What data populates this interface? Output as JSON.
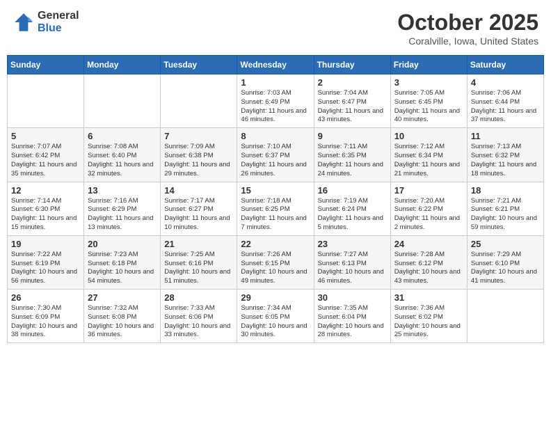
{
  "logo": {
    "general": "General",
    "blue": "Blue"
  },
  "title": "October 2025",
  "location": "Coralville, Iowa, United States",
  "days_of_week": [
    "Sunday",
    "Monday",
    "Tuesday",
    "Wednesday",
    "Thursday",
    "Friday",
    "Saturday"
  ],
  "weeks": [
    [
      {
        "day": "",
        "info": ""
      },
      {
        "day": "",
        "info": ""
      },
      {
        "day": "",
        "info": ""
      },
      {
        "day": "1",
        "info": "Sunrise: 7:03 AM\nSunset: 6:49 PM\nDaylight: 11 hours and 46 minutes."
      },
      {
        "day": "2",
        "info": "Sunrise: 7:04 AM\nSunset: 6:47 PM\nDaylight: 11 hours and 43 minutes."
      },
      {
        "day": "3",
        "info": "Sunrise: 7:05 AM\nSunset: 6:45 PM\nDaylight: 11 hours and 40 minutes."
      },
      {
        "day": "4",
        "info": "Sunrise: 7:06 AM\nSunset: 6:44 PM\nDaylight: 11 hours and 37 minutes."
      }
    ],
    [
      {
        "day": "5",
        "info": "Sunrise: 7:07 AM\nSunset: 6:42 PM\nDaylight: 11 hours and 35 minutes."
      },
      {
        "day": "6",
        "info": "Sunrise: 7:08 AM\nSunset: 6:40 PM\nDaylight: 11 hours and 32 minutes."
      },
      {
        "day": "7",
        "info": "Sunrise: 7:09 AM\nSunset: 6:38 PM\nDaylight: 11 hours and 29 minutes."
      },
      {
        "day": "8",
        "info": "Sunrise: 7:10 AM\nSunset: 6:37 PM\nDaylight: 11 hours and 26 minutes."
      },
      {
        "day": "9",
        "info": "Sunrise: 7:11 AM\nSunset: 6:35 PM\nDaylight: 11 hours and 24 minutes."
      },
      {
        "day": "10",
        "info": "Sunrise: 7:12 AM\nSunset: 6:34 PM\nDaylight: 11 hours and 21 minutes."
      },
      {
        "day": "11",
        "info": "Sunrise: 7:13 AM\nSunset: 6:32 PM\nDaylight: 11 hours and 18 minutes."
      }
    ],
    [
      {
        "day": "12",
        "info": "Sunrise: 7:14 AM\nSunset: 6:30 PM\nDaylight: 11 hours and 15 minutes."
      },
      {
        "day": "13",
        "info": "Sunrise: 7:16 AM\nSunset: 6:29 PM\nDaylight: 11 hours and 13 minutes."
      },
      {
        "day": "14",
        "info": "Sunrise: 7:17 AM\nSunset: 6:27 PM\nDaylight: 11 hours and 10 minutes."
      },
      {
        "day": "15",
        "info": "Sunrise: 7:18 AM\nSunset: 6:25 PM\nDaylight: 11 hours and 7 minutes."
      },
      {
        "day": "16",
        "info": "Sunrise: 7:19 AM\nSunset: 6:24 PM\nDaylight: 11 hours and 5 minutes."
      },
      {
        "day": "17",
        "info": "Sunrise: 7:20 AM\nSunset: 6:22 PM\nDaylight: 11 hours and 2 minutes."
      },
      {
        "day": "18",
        "info": "Sunrise: 7:21 AM\nSunset: 6:21 PM\nDaylight: 10 hours and 59 minutes."
      }
    ],
    [
      {
        "day": "19",
        "info": "Sunrise: 7:22 AM\nSunset: 6:19 PM\nDaylight: 10 hours and 56 minutes."
      },
      {
        "day": "20",
        "info": "Sunrise: 7:23 AM\nSunset: 6:18 PM\nDaylight: 10 hours and 54 minutes."
      },
      {
        "day": "21",
        "info": "Sunrise: 7:25 AM\nSunset: 6:16 PM\nDaylight: 10 hours and 51 minutes."
      },
      {
        "day": "22",
        "info": "Sunrise: 7:26 AM\nSunset: 6:15 PM\nDaylight: 10 hours and 49 minutes."
      },
      {
        "day": "23",
        "info": "Sunrise: 7:27 AM\nSunset: 6:13 PM\nDaylight: 10 hours and 46 minutes."
      },
      {
        "day": "24",
        "info": "Sunrise: 7:28 AM\nSunset: 6:12 PM\nDaylight: 10 hours and 43 minutes."
      },
      {
        "day": "25",
        "info": "Sunrise: 7:29 AM\nSunset: 6:10 PM\nDaylight: 10 hours and 41 minutes."
      }
    ],
    [
      {
        "day": "26",
        "info": "Sunrise: 7:30 AM\nSunset: 6:09 PM\nDaylight: 10 hours and 38 minutes."
      },
      {
        "day": "27",
        "info": "Sunrise: 7:32 AM\nSunset: 6:08 PM\nDaylight: 10 hours and 36 minutes."
      },
      {
        "day": "28",
        "info": "Sunrise: 7:33 AM\nSunset: 6:06 PM\nDaylight: 10 hours and 33 minutes."
      },
      {
        "day": "29",
        "info": "Sunrise: 7:34 AM\nSunset: 6:05 PM\nDaylight: 10 hours and 30 minutes."
      },
      {
        "day": "30",
        "info": "Sunrise: 7:35 AM\nSunset: 6:04 PM\nDaylight: 10 hours and 28 minutes."
      },
      {
        "day": "31",
        "info": "Sunrise: 7:36 AM\nSunset: 6:02 PM\nDaylight: 10 hours and 25 minutes."
      },
      {
        "day": "",
        "info": ""
      }
    ]
  ]
}
